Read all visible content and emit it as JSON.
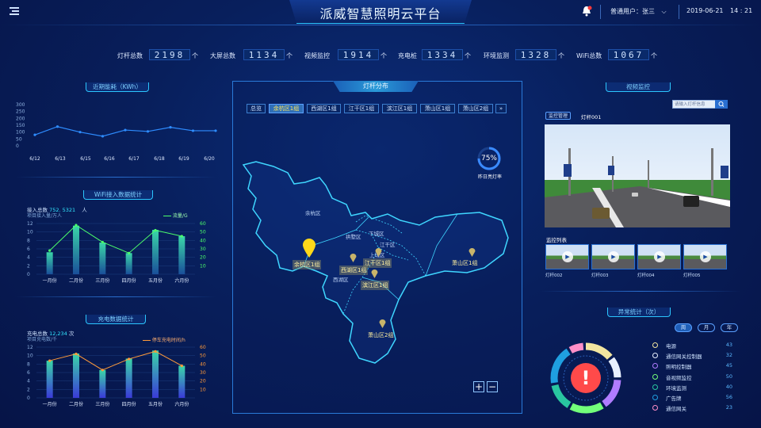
{
  "header": {
    "title": "派威智慧照明云平台",
    "user": "普通用户：张三",
    "date": "2019-06-21",
    "time": "14 : 21"
  },
  "stats": [
    {
      "label": "灯杆总数",
      "value": "2198",
      "unit": "个"
    },
    {
      "label": "大屏总数",
      "value": "1134",
      "unit": "个"
    },
    {
      "label": "视频监控",
      "value": "1914",
      "unit": "个"
    },
    {
      "label": "充电桩",
      "value": "1334",
      "unit": "个"
    },
    {
      "label": "环境监测",
      "value": "1328",
      "unit": "个"
    },
    {
      "label": "WiFi总数",
      "value": "1067",
      "unit": "个"
    }
  ],
  "energy": {
    "title": "近期能耗（KWh）"
  },
  "wifi": {
    "title": "WiFi接入数据统计",
    "total_label": "接入总数",
    "total_value": "752. 5321",
    "total_unit": "人",
    "left_axis_label": "项目接入量/万人",
    "legend": "流量/G"
  },
  "charge": {
    "title": "充电数据统计",
    "total_label": "充电总数",
    "total_value": "12,234",
    "total_unit": "次",
    "left_axis_label": "项目充电数/千",
    "legend": "停车充电时间/h"
  },
  "map": {
    "title": "灯杆分布",
    "tabs": [
      "总览",
      "余杭区1组",
      "西湖区1组",
      "江干区1组",
      "滨江区1组",
      "萧山区1组",
      "萧山区2组"
    ],
    "more": "»",
    "rate_value": "75%",
    "rate_fraction": 0.75,
    "rate_label": "昨日亮灯率",
    "districts": [
      "余杭区",
      "拱墅区",
      "下城区",
      "江干区",
      "西湖区",
      "上城区"
    ],
    "pins": [
      "余杭区1组",
      "西湖区1组",
      "江干区1组",
      "滨江区1组",
      "萧山区1组",
      "萧山区2组"
    ],
    "zoom_in": "+",
    "zoom_out": "−"
  },
  "video": {
    "title": "视频监控",
    "search_placeholder": "请输入灯杆信息",
    "manage_label": "监控管理",
    "current_pole": "灯杆001",
    "list_title": "监控列表",
    "thumbs": [
      "灯杆002",
      "灯杆003",
      "灯杆004",
      "灯杆005"
    ]
  },
  "alarm": {
    "title": "异常统计（次）",
    "periods": [
      "周",
      "月",
      "年"
    ],
    "items": [
      {
        "name": "电源",
        "value": "43",
        "color": "#f2e6a0"
      },
      {
        "name": "通信网关控制器",
        "value": "32",
        "color": "#e8f0ff"
      },
      {
        "name": "照明控制器",
        "value": "45",
        "color": "#b07cff"
      },
      {
        "name": "音视频监控",
        "value": "50",
        "color": "#72ff7a"
      },
      {
        "name": "环境监测",
        "value": "40",
        "color": "#29c6a0"
      },
      {
        "name": "广告牌",
        "value": "56",
        "color": "#1f9fe0"
      },
      {
        "name": "通信网关",
        "value": "23",
        "color": "#ff8fc8"
      }
    ]
  },
  "chart_data": [
    {
      "type": "line",
      "title": "近期能耗（KWh）",
      "categories": [
        "6/12",
        "6/13",
        "6/15",
        "6/16",
        "6/17",
        "6/18",
        "6/19",
        "6/20"
      ],
      "y_ticks": [
        "300",
        "250",
        "200",
        "150",
        "100",
        "50",
        "0"
      ],
      "ylim": [
        0,
        300
      ],
      "values": [
        80,
        140,
        100,
        70,
        115,
        105,
        135,
        110,
        110
      ]
    },
    {
      "type": "bar",
      "title": "WiFi接入数据统计",
      "categories": [
        "一月份",
        "二月份",
        "三月份",
        "四月份",
        "五月份",
        "六月份"
      ],
      "y_ticks": [
        "12",
        "10",
        "8",
        "6",
        "4",
        "2",
        "0"
      ],
      "y2_ticks": [
        "60",
        "50",
        "40",
        "30",
        "20",
        "10"
      ],
      "ylim": [
        0,
        12
      ],
      "y2lim": [
        0,
        60
      ],
      "series": [
        {
          "name": "项目接入量/万人",
          "values": [
            5.2,
            11.5,
            7.5,
            5.0,
            10.5,
            9.0
          ]
        },
        {
          "name": "流量/G",
          "values": [
            28,
            58,
            38,
            25,
            52,
            45
          ]
        }
      ]
    },
    {
      "type": "bar",
      "title": "充电数据统计",
      "categories": [
        "一月份",
        "二月份",
        "三月份",
        "四月份",
        "五月份",
        "六月份"
      ],
      "y_ticks": [
        "12",
        "10",
        "8",
        "6",
        "4",
        "2",
        "0"
      ],
      "y2_ticks": [
        "60",
        "50",
        "40",
        "30",
        "20",
        "10"
      ],
      "ylim": [
        0,
        12
      ],
      "y2lim": [
        0,
        60
      ],
      "series": [
        {
          "name": "项目充电数/千",
          "values": [
            8.8,
            10.5,
            6.6,
            9.3,
            11.2,
            7.6
          ]
        },
        {
          "name": "停车充电时间/h",
          "values": [
            44,
            52,
            33,
            46,
            55,
            38
          ]
        }
      ]
    }
  ]
}
